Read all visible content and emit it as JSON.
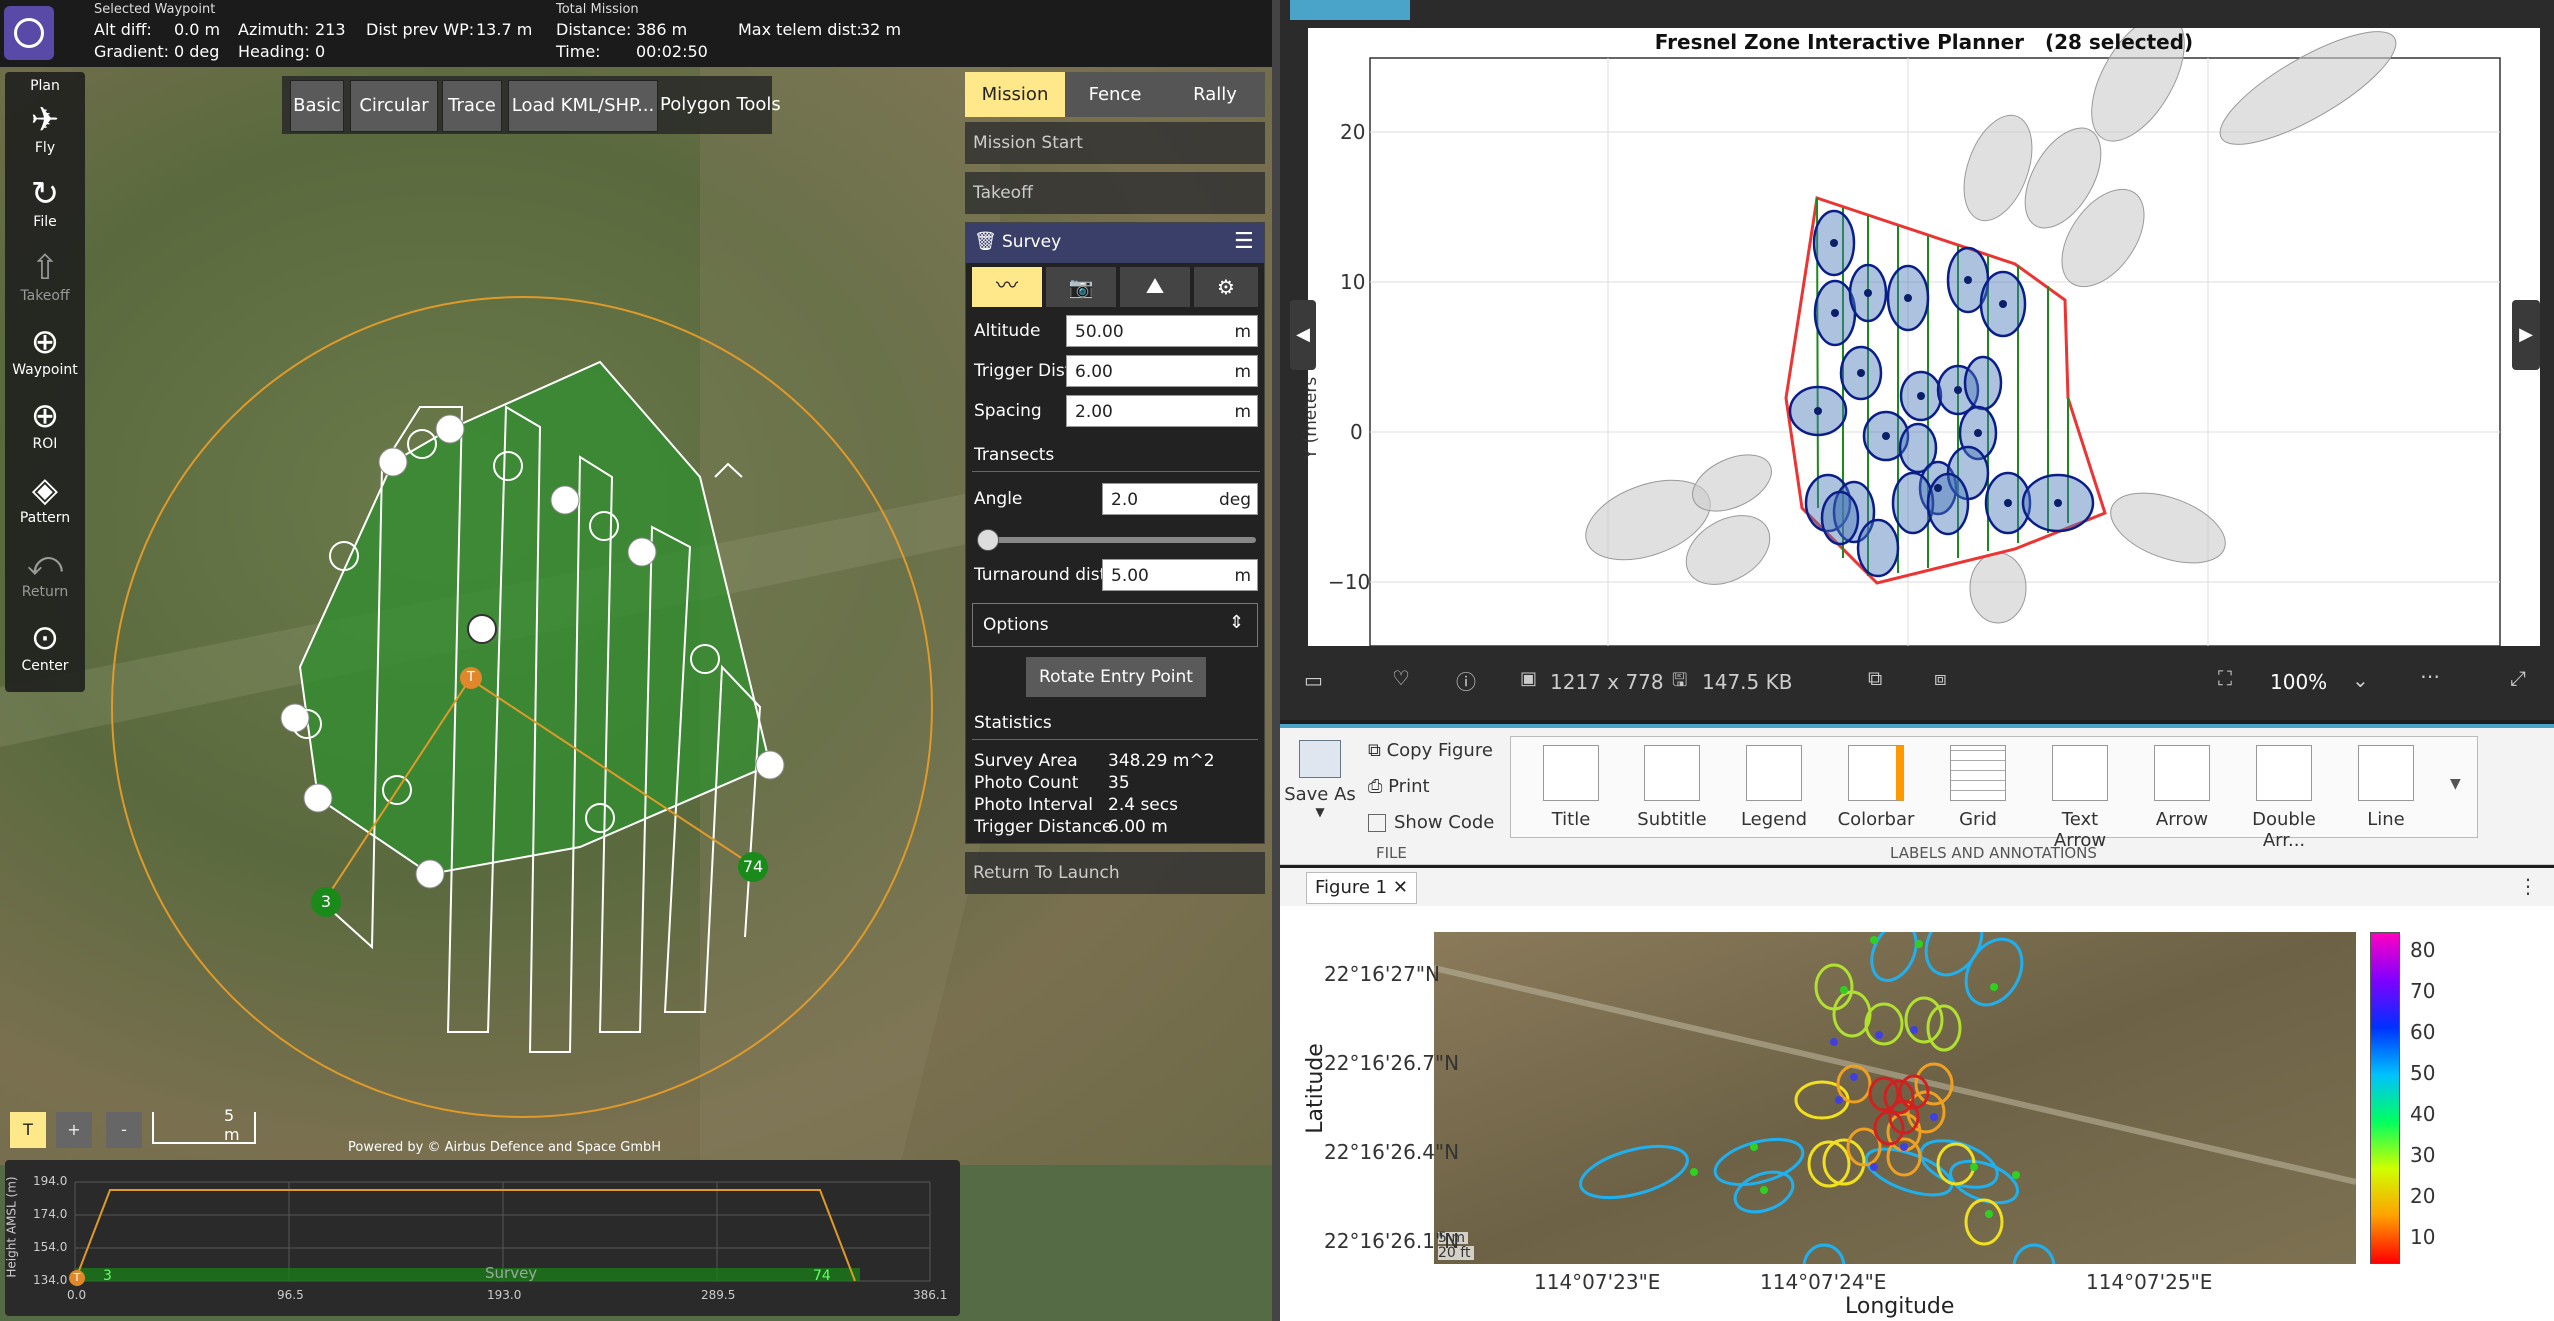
{
  "qgc": {
    "header": {
      "selected_wp_label": "Selected Waypoint",
      "alt_diff_label": "Alt diff:",
      "alt_diff": "0.0 m",
      "gradient_label": "Gradient:",
      "gradient": "0 deg",
      "azimuth_label": "Azimuth:",
      "azimuth": "213",
      "heading_label": "Heading:",
      "heading": "0",
      "dist_prev_label": "Dist prev WP:",
      "dist_prev": "13.7 m",
      "total_mission_label": "Total Mission",
      "distance_label": "Distance:",
      "distance": "386 m",
      "time_label": "Time:",
      "time": "00:02:50",
      "max_telem_label": "Max telem dist:",
      "max_telem": "32 m"
    },
    "toolstrip": [
      {
        "label": "Fly",
        "icon": "paper-plane-icon",
        "enabled": true
      },
      {
        "label": "File",
        "icon": "sync-icon",
        "enabled": true
      },
      {
        "label": "Takeoff",
        "icon": "takeoff-icon",
        "enabled": false
      },
      {
        "label": "Waypoint",
        "icon": "plus-circle-icon",
        "enabled": true
      },
      {
        "label": "ROI",
        "icon": "plus-circle-icon",
        "enabled": true
      },
      {
        "label": "Pattern",
        "icon": "pattern-icon",
        "enabled": true
      },
      {
        "label": "Return",
        "icon": "return-icon",
        "enabled": false
      },
      {
        "label": "Center",
        "icon": "crosshair-icon",
        "enabled": true
      }
    ],
    "plan_label": "Plan",
    "polygon_tools": {
      "buttons": [
        "Basic",
        "Circular",
        "Trace",
        "Load KML/SHP..."
      ],
      "label": "Polygon Tools"
    },
    "plan_tabs": [
      "Mission",
      "Fence",
      "Rally"
    ],
    "mission_items": [
      "Mission Start",
      "Takeoff"
    ],
    "survey": {
      "title": "Survey",
      "altitude_label": "Altitude",
      "altitude": "50.00",
      "altitude_unit": "m",
      "trigger_label": "Trigger Dist",
      "trigger": "6.00",
      "trigger_unit": "m",
      "spacing_label": "Spacing",
      "spacing": "2.00",
      "spacing_unit": "m",
      "transects_label": "Transects",
      "angle_label": "Angle",
      "angle": "2.0",
      "angle_unit": "deg",
      "angle_fraction": 0.011,
      "turnaround_label": "Turnaround dist",
      "turnaround": "5.00",
      "turnaround_unit": "m",
      "options_label": "Options",
      "rotate_label": "Rotate Entry Point",
      "statistics_label": "Statistics",
      "stats": [
        {
          "k": "Survey Area",
          "v": "348.29 m^2"
        },
        {
          "k": "Photo Count",
          "v": "35"
        },
        {
          "k": "Photo Interval",
          "v": "2.4 secs"
        },
        {
          "k": "Trigger Distance",
          "v": "6.00 m"
        }
      ]
    },
    "return_to_launch": "Return To Launch",
    "waypoints": {
      "start": "3",
      "end": "74",
      "takeoff": "T"
    },
    "zoom_buttons": [
      "T",
      "+",
      "-"
    ],
    "scale_label": "5 m",
    "attribution": "Powered by © Airbus Defence and Space GmbH",
    "elevation": {
      "ylabel": "Height AMSL (m)",
      "yticks": [
        "194.0",
        "174.0",
        "154.0",
        "134.0"
      ],
      "xticks": [
        "0.0",
        "96.5",
        "193.0",
        "289.5",
        "386.1"
      ],
      "survey_label": "Survey",
      "start_wp": "3",
      "end_wp": "74",
      "takeoff": "T"
    }
  },
  "figure_top": {
    "title": "Fresnel Zone Interactive Planner",
    "subtitle": "(28 selected)",
    "ylabel": "Y (meters",
    "yticks": [
      "20",
      "10",
      "0",
      "−10"
    ],
    "image_info": {
      "size": "1217 x 778",
      "filesize": "147.5 KB",
      "zoom": "100%"
    }
  },
  "ribbon": {
    "save_as": "Save As",
    "copy_figure": "Copy Figure",
    "print": "Print",
    "show_code": "Show Code",
    "file_group": "FILE",
    "items": [
      "Title",
      "Subtitle",
      "Legend",
      "Colorbar",
      "Grid",
      "Text Arrow",
      "Arrow",
      "Double Arr...",
      "Line"
    ],
    "labels_group": "LABELS AND ANNOTATIONS"
  },
  "figure1": {
    "tab": "Figure 1",
    "ylabel": "Latitude",
    "xlabel": "Longitude",
    "yticks": [
      "22°16'27\"N",
      "22°16'26.7\"N",
      "22°16'26.4\"N",
      "22°16'26.1\"N"
    ],
    "xticks": [
      "114°07'23\"E",
      "114°07'24\"E",
      "114°07'25\"E"
    ],
    "colorbar_ticks": [
      "80",
      "70",
      "60",
      "50",
      "40",
      "30",
      "20",
      "10"
    ],
    "scale_m": "5 m",
    "scale_ft": "20 ft"
  }
}
